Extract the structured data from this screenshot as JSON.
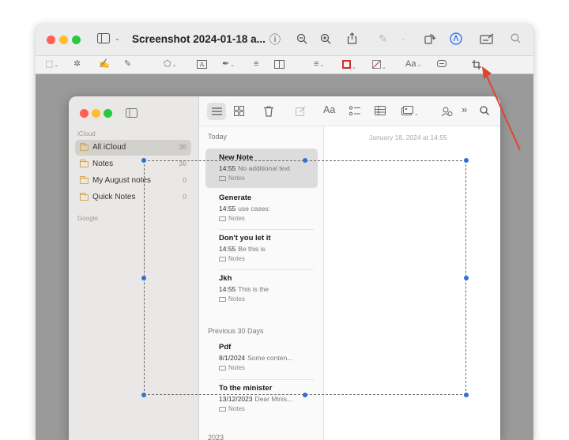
{
  "preview": {
    "title": "Screenshot 2024-01-18 a...",
    "accent_color": "#3478f6",
    "annotation_arrow_color": "#e0442f",
    "toolbar_icons": [
      "sidebar-icon",
      "info-icon",
      "zoom-out-icon",
      "zoom-in-icon",
      "share-icon",
      "highlight-icon",
      "rotate-icon",
      "markup-icon",
      "form-fill-icon",
      "search-icon"
    ],
    "markup_icons": [
      "rect-select-icon",
      "magic-select-icon",
      "sketch-icon",
      "draw-icon",
      "shapes-icon",
      "text-box-icon",
      "sign-icon",
      "align-icon",
      "page-layout-icon",
      "line-style-icon",
      "border-color-icon",
      "fill-color-icon",
      "text-style-icon",
      "notes-icon",
      "crop-icon"
    ],
    "text_style_label": "Aa"
  },
  "notes": {
    "toolbar": {
      "format_label": "Aa"
    },
    "sidebar": {
      "icloud_heading": "iCloud",
      "google_heading": "Google",
      "items": [
        {
          "label": "All iCloud",
          "count": "36",
          "selected": true
        },
        {
          "label": "Notes",
          "count": "36",
          "selected": false
        },
        {
          "label": "My August notes",
          "count": "0",
          "selected": false
        },
        {
          "label": "Quick Notes",
          "count": "0",
          "selected": false
        }
      ]
    },
    "list": {
      "today_heading": "Today",
      "previous_heading": "Previous 30 Days",
      "year_heading": "2023",
      "notes": [
        {
          "title": "New Note",
          "time": "14:55",
          "preview": "No additional text",
          "folder": "Notes",
          "selected": true
        },
        {
          "title": "Generate",
          "time": "14:55",
          "preview": "use cases:",
          "folder": "Notes",
          "selected": false
        },
        {
          "title": "Don't you let it",
          "time": "14:55",
          "preview": "Be this is",
          "folder": "Notes",
          "selected": false
        },
        {
          "title": "Jkh",
          "time": "14:55",
          "preview": "This is the",
          "folder": "Notes",
          "selected": false
        },
        {
          "title": "Pdf",
          "time": "8/1/2024",
          "preview": "Some conten...",
          "folder": "Notes",
          "selected": false
        },
        {
          "title": "To the minister",
          "time": "13/12/2023",
          "preview": "Dear Minis...",
          "folder": "Notes",
          "selected": false
        }
      ]
    },
    "editor": {
      "date": "January 18, 2024 at 14:55"
    }
  }
}
